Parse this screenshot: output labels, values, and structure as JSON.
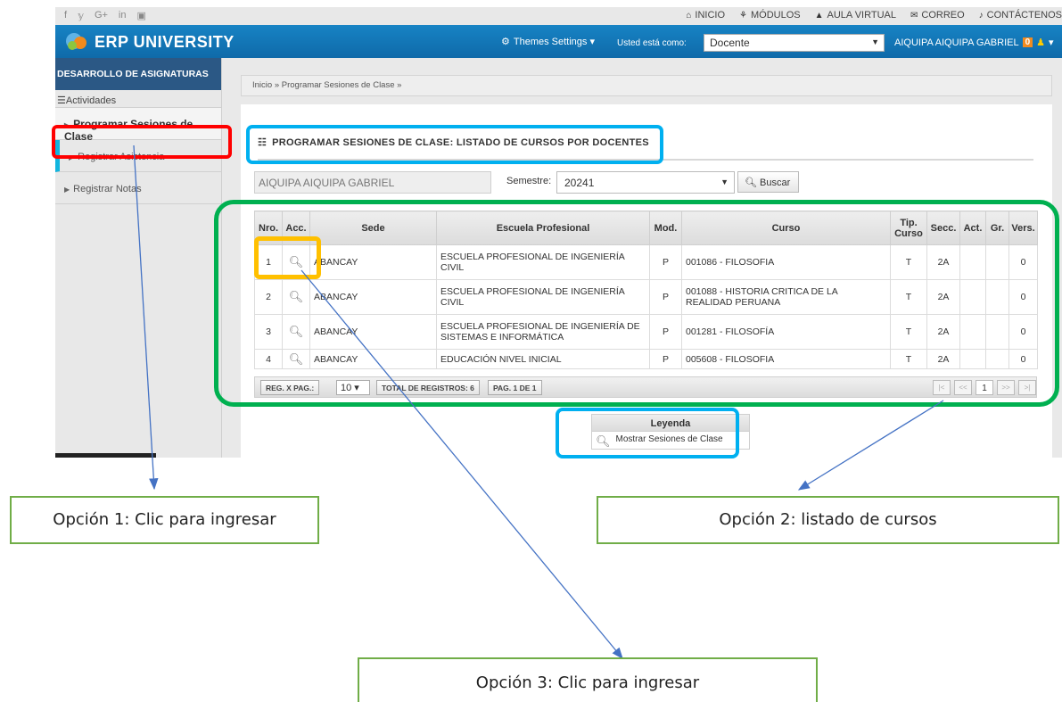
{
  "topbar": {
    "social": [
      "f",
      "𝕪",
      "G+",
      "in",
      "▣"
    ],
    "links": [
      {
        "icon": "home-icon",
        "label": "INICIO"
      },
      {
        "icon": "sitemap-icon",
        "label": "MÓDULOS"
      },
      {
        "icon": "graduation-cap-icon",
        "label": "AULA VIRTUAL"
      },
      {
        "icon": "envelope-icon",
        "label": "CORREO"
      },
      {
        "icon": "bell-icon",
        "label": "CONTÁCTENOS"
      }
    ]
  },
  "header": {
    "logo_text": "ERP UNIVERSITY",
    "themes": "Themes Settings",
    "usted": "Usted está como:",
    "role": "Docente",
    "user_name": "AIQUIPA AIQUIPA GABRIEL",
    "notif_count": "0"
  },
  "sidebar": {
    "title": "DESARROLLO DE ASIGNATURAS",
    "section": "Actividades",
    "items": [
      {
        "label": "Programar Sesiones de Clase"
      },
      {
        "label": "Registrar Asistencia"
      },
      {
        "label": "Registrar Notas"
      }
    ]
  },
  "breadcrumb": {
    "home": "Inicio",
    "sep": "»",
    "current": "Programar Sesiones de Clase"
  },
  "panel": {
    "title": "PROGRAMAR SESIONES DE CLASE: LISTADO DE CURSOS POR DOCENTES",
    "teacher": "AIQUIPA AIQUIPA GABRIEL",
    "semester_label": "Semestre:",
    "semester": "20241",
    "search_button": "Buscar"
  },
  "table": {
    "headers": [
      "Nro.",
      "Acc.",
      "Sede",
      "Escuela Profesional",
      "Mod.",
      "Curso",
      "Tip. Curso",
      "Secc.",
      "Act.",
      "Gr.",
      "Vers."
    ],
    "rows": [
      {
        "nro": "1",
        "sede": "ABANCAY",
        "escuela": "ESCUELA PROFESIONAL DE INGENIERÍA CIVIL",
        "mod": "P",
        "curso": "001086 - FILOSOFIA",
        "tip": "T",
        "secc": "2A",
        "act": "",
        "gr": "",
        "vers": "0"
      },
      {
        "nro": "2",
        "sede": "ABANCAY",
        "escuela": "ESCUELA PROFESIONAL DE INGENIERÍA CIVIL",
        "mod": "P",
        "curso": "001088 - HISTORIA CRITICA DE LA REALIDAD PERUANA",
        "tip": "T",
        "secc": "2A",
        "act": "",
        "gr": "",
        "vers": "0"
      },
      {
        "nro": "3",
        "sede": "ABANCAY",
        "escuela": "ESCUELA PROFESIONAL DE INGENIERÍA DE SISTEMAS E INFORMÁTICA",
        "mod": "P",
        "curso": "001281 - FILOSOFÍA",
        "tip": "T",
        "secc": "2A",
        "act": "",
        "gr": "",
        "vers": "0"
      },
      {
        "nro": "4",
        "sede": "ABANCAY",
        "escuela": "EDUCACIÓN NIVEL INICIAL",
        "mod": "P",
        "curso": "005608 - FILOSOFIA",
        "tip": "T",
        "secc": "2A",
        "act": "",
        "gr": "",
        "vers": "0"
      }
    ]
  },
  "pager": {
    "per_page_label": "REG. X PAG.:",
    "per_page": "10",
    "total": "TOTAL DE REGISTROS: 6",
    "page": "PAG. 1 DE 1",
    "nav": [
      "|<",
      "<<",
      "1",
      ">>",
      ">|"
    ]
  },
  "legend": {
    "title": "Leyenda",
    "item": "Mostrar Sesiones de Clase"
  },
  "notes": {
    "opcion1": "Opción 1: Clic para ingresar",
    "opcion2": "Opción 2: listado de cursos",
    "opcion3": "Opción 3: Clic para ingresar"
  },
  "colors": {
    "header_blue": "#1783c4",
    "sidebar_title": "#2b5885",
    "accent_cyan": "#12b5de",
    "highlight_red": "#ff0000",
    "highlight_blue": "#00b0f0",
    "highlight_green": "#00b050",
    "highlight_orange": "#ffc000",
    "note_border": "#70ad47",
    "arrow": "#4472c4"
  }
}
